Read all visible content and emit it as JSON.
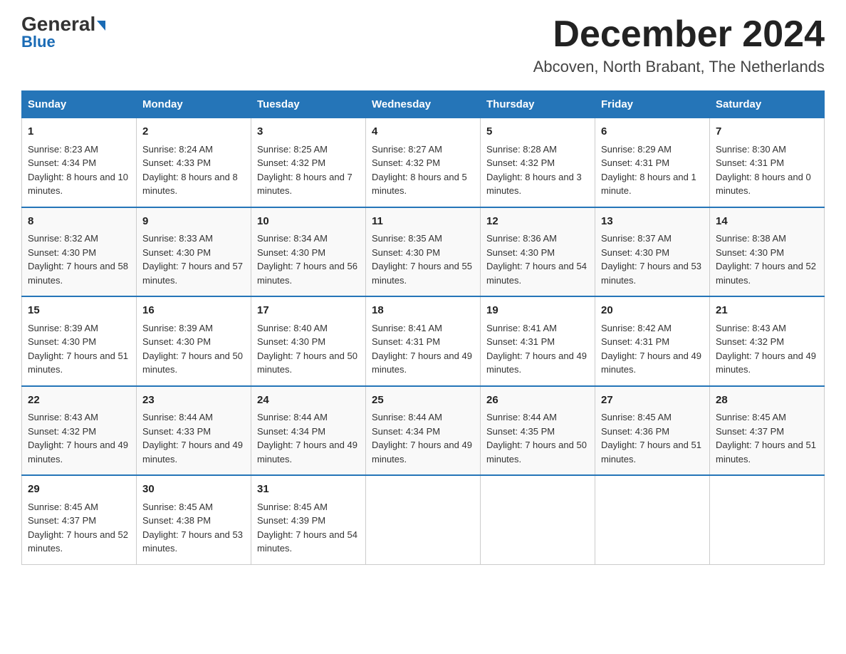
{
  "header": {
    "logo_general": "General",
    "logo_blue": "Blue",
    "month_title": "December 2024",
    "location": "Abcoven, North Brabant, The Netherlands"
  },
  "weekdays": [
    "Sunday",
    "Monday",
    "Tuesday",
    "Wednesday",
    "Thursday",
    "Friday",
    "Saturday"
  ],
  "weeks": [
    [
      {
        "day": "1",
        "sunrise": "8:23 AM",
        "sunset": "4:34 PM",
        "daylight": "8 hours and 10 minutes."
      },
      {
        "day": "2",
        "sunrise": "8:24 AM",
        "sunset": "4:33 PM",
        "daylight": "8 hours and 8 minutes."
      },
      {
        "day": "3",
        "sunrise": "8:25 AM",
        "sunset": "4:32 PM",
        "daylight": "8 hours and 7 minutes."
      },
      {
        "day": "4",
        "sunrise": "8:27 AM",
        "sunset": "4:32 PM",
        "daylight": "8 hours and 5 minutes."
      },
      {
        "day": "5",
        "sunrise": "8:28 AM",
        "sunset": "4:32 PM",
        "daylight": "8 hours and 3 minutes."
      },
      {
        "day": "6",
        "sunrise": "8:29 AM",
        "sunset": "4:31 PM",
        "daylight": "8 hours and 1 minute."
      },
      {
        "day": "7",
        "sunrise": "8:30 AM",
        "sunset": "4:31 PM",
        "daylight": "8 hours and 0 minutes."
      }
    ],
    [
      {
        "day": "8",
        "sunrise": "8:32 AM",
        "sunset": "4:30 PM",
        "daylight": "7 hours and 58 minutes."
      },
      {
        "day": "9",
        "sunrise": "8:33 AM",
        "sunset": "4:30 PM",
        "daylight": "7 hours and 57 minutes."
      },
      {
        "day": "10",
        "sunrise": "8:34 AM",
        "sunset": "4:30 PM",
        "daylight": "7 hours and 56 minutes."
      },
      {
        "day": "11",
        "sunrise": "8:35 AM",
        "sunset": "4:30 PM",
        "daylight": "7 hours and 55 minutes."
      },
      {
        "day": "12",
        "sunrise": "8:36 AM",
        "sunset": "4:30 PM",
        "daylight": "7 hours and 54 minutes."
      },
      {
        "day": "13",
        "sunrise": "8:37 AM",
        "sunset": "4:30 PM",
        "daylight": "7 hours and 53 minutes."
      },
      {
        "day": "14",
        "sunrise": "8:38 AM",
        "sunset": "4:30 PM",
        "daylight": "7 hours and 52 minutes."
      }
    ],
    [
      {
        "day": "15",
        "sunrise": "8:39 AM",
        "sunset": "4:30 PM",
        "daylight": "7 hours and 51 minutes."
      },
      {
        "day": "16",
        "sunrise": "8:39 AM",
        "sunset": "4:30 PM",
        "daylight": "7 hours and 50 minutes."
      },
      {
        "day": "17",
        "sunrise": "8:40 AM",
        "sunset": "4:30 PM",
        "daylight": "7 hours and 50 minutes."
      },
      {
        "day": "18",
        "sunrise": "8:41 AM",
        "sunset": "4:31 PM",
        "daylight": "7 hours and 49 minutes."
      },
      {
        "day": "19",
        "sunrise": "8:41 AM",
        "sunset": "4:31 PM",
        "daylight": "7 hours and 49 minutes."
      },
      {
        "day": "20",
        "sunrise": "8:42 AM",
        "sunset": "4:31 PM",
        "daylight": "7 hours and 49 minutes."
      },
      {
        "day": "21",
        "sunrise": "8:43 AM",
        "sunset": "4:32 PM",
        "daylight": "7 hours and 49 minutes."
      }
    ],
    [
      {
        "day": "22",
        "sunrise": "8:43 AM",
        "sunset": "4:32 PM",
        "daylight": "7 hours and 49 minutes."
      },
      {
        "day": "23",
        "sunrise": "8:44 AM",
        "sunset": "4:33 PM",
        "daylight": "7 hours and 49 minutes."
      },
      {
        "day": "24",
        "sunrise": "8:44 AM",
        "sunset": "4:34 PM",
        "daylight": "7 hours and 49 minutes."
      },
      {
        "day": "25",
        "sunrise": "8:44 AM",
        "sunset": "4:34 PM",
        "daylight": "7 hours and 49 minutes."
      },
      {
        "day": "26",
        "sunrise": "8:44 AM",
        "sunset": "4:35 PM",
        "daylight": "7 hours and 50 minutes."
      },
      {
        "day": "27",
        "sunrise": "8:45 AM",
        "sunset": "4:36 PM",
        "daylight": "7 hours and 51 minutes."
      },
      {
        "day": "28",
        "sunrise": "8:45 AM",
        "sunset": "4:37 PM",
        "daylight": "7 hours and 51 minutes."
      }
    ],
    [
      {
        "day": "29",
        "sunrise": "8:45 AM",
        "sunset": "4:37 PM",
        "daylight": "7 hours and 52 minutes."
      },
      {
        "day": "30",
        "sunrise": "8:45 AM",
        "sunset": "4:38 PM",
        "daylight": "7 hours and 53 minutes."
      },
      {
        "day": "31",
        "sunrise": "8:45 AM",
        "sunset": "4:39 PM",
        "daylight": "7 hours and 54 minutes."
      },
      null,
      null,
      null,
      null
    ]
  ],
  "labels": {
    "sunrise": "Sunrise:",
    "sunset": "Sunset:",
    "daylight": "Daylight:"
  }
}
